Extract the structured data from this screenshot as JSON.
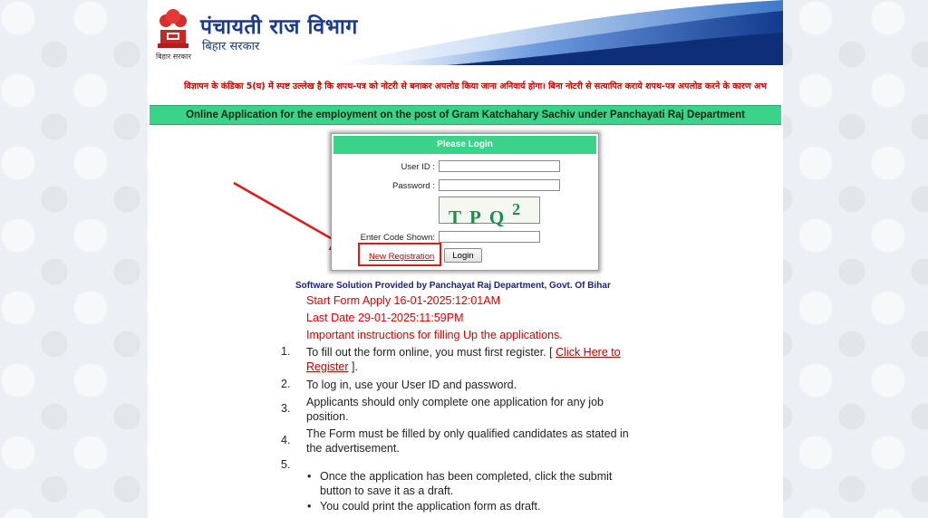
{
  "header": {
    "title": "पंचायती राज विभाग",
    "subtitle": "बिहार सरकार",
    "emblem_caption": "बिहार सरकार"
  },
  "notice": "विज्ञापन के कंडिका 5(घ) में स्पष्ट उल्लेख है कि शपथ-पत्र को नोटरी से बनाकर अपलोड किया जाना अनिवार्य होगा। बिना नोटरी से सत्यापित कराये शपथ-पत्र अपलोड करने के कारण अभ",
  "banner": "Online Application for the employment on the post of Gram Katchahary Sachiv under Panchayati Raj Department",
  "login": {
    "title": "Please Login",
    "userid_label": "User ID :",
    "password_label": "Password :",
    "captcha_text": "TPQ",
    "captcha_sup": "2",
    "code_label": "Enter Code Shown:",
    "new_registration": "New Registration",
    "login_button": "Login"
  },
  "provider": "Software Solution Provided by Panchayat Raj Department, Govt. Of Bihar",
  "dates": {
    "start": "Start Form Apply 16-01-2025:12:01AM",
    "last": "Last Date 29-01-2025:11:59PM",
    "instructions_heading": "Important instructions for filling Up the applications."
  },
  "instructions": [
    {
      "num": "1.",
      "pre": "To fill out the form online, you must first register. [ ",
      "link": "Click Here to Register",
      "post": " ]."
    },
    {
      "num": "2.",
      "text": "To log in, use your User ID and password."
    },
    {
      "num": "3.",
      "text": "Applicants should only complete one application for any job position."
    },
    {
      "num": "4.",
      "text": "The Form must be filled by only qualified candidates as stated in the advertisement."
    },
    {
      "num": "5.",
      "text": ""
    }
  ],
  "bullets": [
    "Once the application has been completed, click the submit button to save it as a draft.",
    "You could print the application form as draft."
  ],
  "colors": {
    "banner_green": "#3bd28a",
    "notice_red": "#cc0000",
    "header_blue": "#1b3a8a",
    "highlight_red": "#e01818"
  }
}
